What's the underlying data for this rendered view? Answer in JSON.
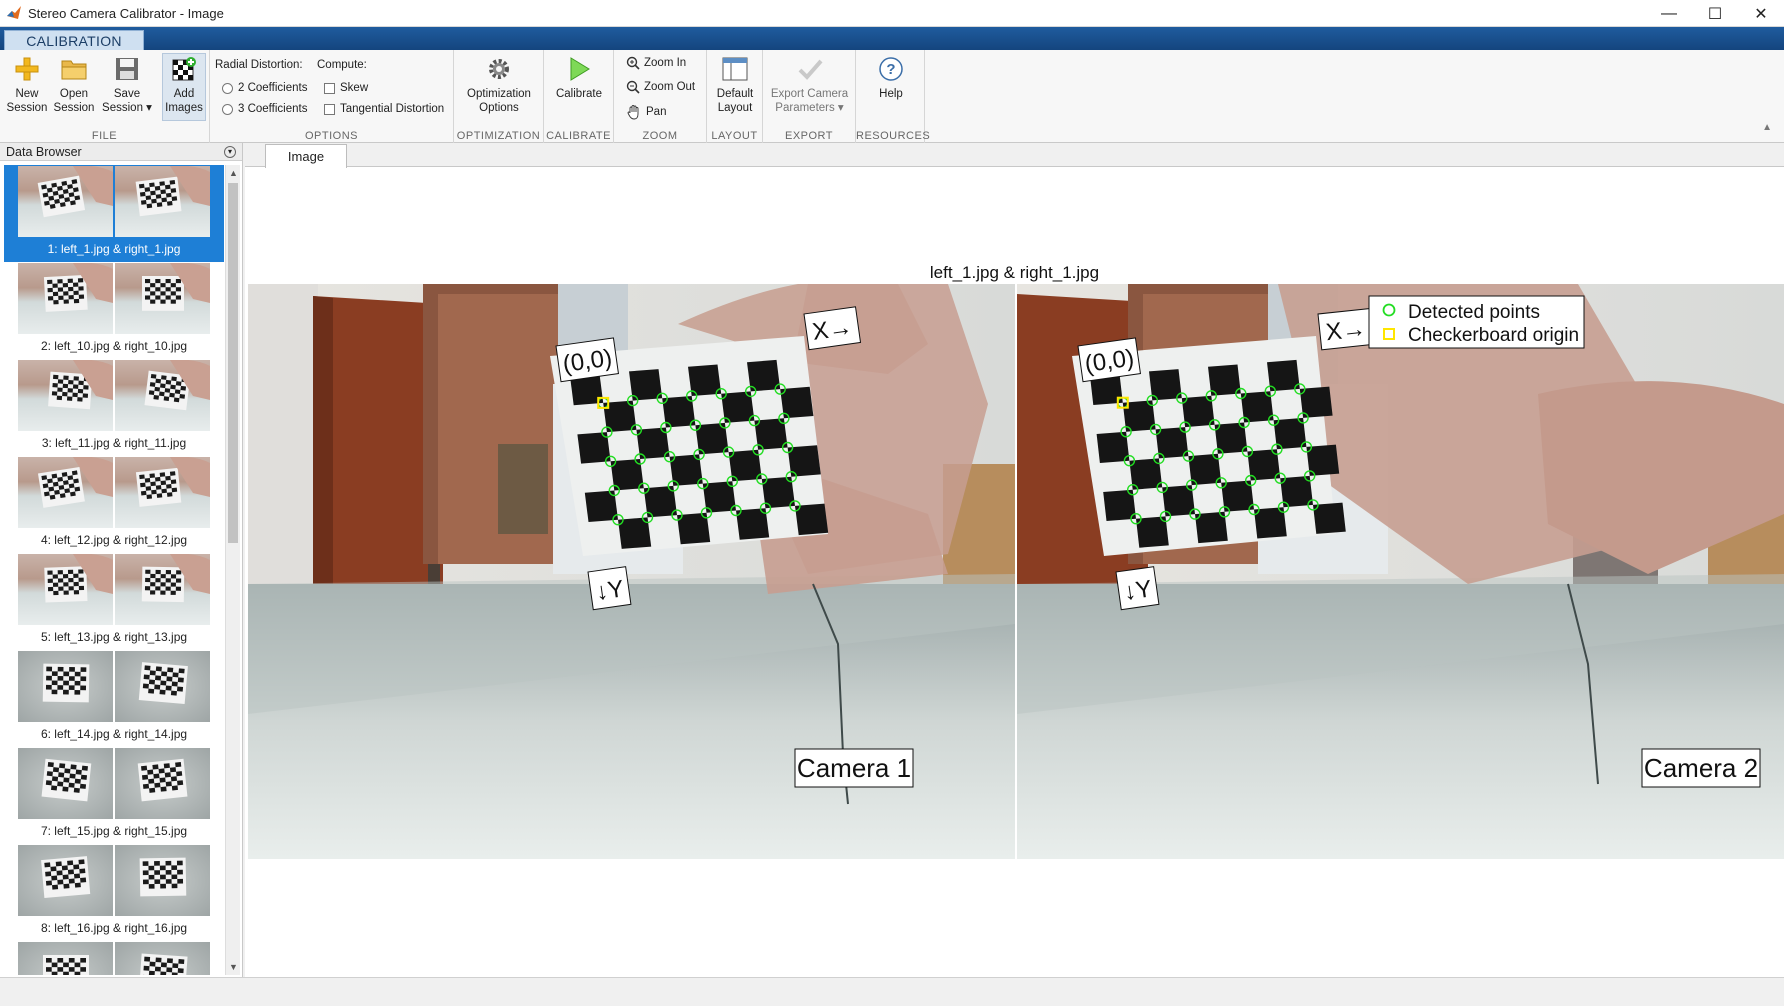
{
  "window": {
    "title": "Stereo Camera Calibrator - Image",
    "minimize": "—",
    "maximize": "☐",
    "close": "✕"
  },
  "ribbon_tab": "CALIBRATION",
  "file": {
    "label": "FILE",
    "new_session": [
      "New",
      "Session"
    ],
    "open_session": [
      "Open",
      "Session"
    ],
    "save_session": [
      "Save",
      "Session ▾"
    ],
    "add_images": [
      "Add",
      "Images"
    ]
  },
  "options": {
    "label": "OPTIONS",
    "radial_distortion": "Radial Distortion:",
    "coef2": "2 Coefficients",
    "coef3": "3 Coefficients",
    "compute": "Compute:",
    "skew": "Skew",
    "tangential": "Tangential Distortion"
  },
  "optimization": {
    "label": "OPTIMIZATION",
    "button": [
      "Optimization",
      "Options"
    ]
  },
  "calibrate": {
    "label": "CALIBRATE",
    "button": "Calibrate"
  },
  "zoom": {
    "label": "ZOOM",
    "zoom_in": "Zoom In",
    "zoom_out": "Zoom Out",
    "pan": "Pan"
  },
  "layout": {
    "label": "LAYOUT",
    "button": [
      "Default",
      "Layout"
    ]
  },
  "export": {
    "label": "EXPORT",
    "button": [
      "Export Camera",
      "Parameters ▾"
    ]
  },
  "resources": {
    "label": "RESOURCES",
    "button": "Help"
  },
  "browser": {
    "title": "Data Browser",
    "items": [
      {
        "label": "1: left_1.jpg & right_1.jpg",
        "selected": true,
        "style": "room"
      },
      {
        "label": "2: left_10.jpg & right_10.jpg",
        "style": "room"
      },
      {
        "label": "3: left_11.jpg & right_11.jpg",
        "style": "room"
      },
      {
        "label": "4: left_12.jpg & right_12.jpg",
        "style": "room"
      },
      {
        "label": "5: left_13.jpg & right_13.jpg",
        "style": "room"
      },
      {
        "label": "6: left_14.jpg & right_14.jpg",
        "style": "gray"
      },
      {
        "label": "7: left_15.jpg & right_15.jpg",
        "style": "gray"
      },
      {
        "label": "8: left_16.jpg & right_16.jpg",
        "style": "gray"
      },
      {
        "label": "",
        "style": "gray"
      }
    ]
  },
  "document_tab": "Image",
  "figure": {
    "title": "left_1.jpg & right_1.jpg",
    "camera1": "Camera 1",
    "camera2": "Camera 2",
    "origin_label": "(0,0)",
    "x_label": "X→",
    "y_label": "↓Y",
    "legend": {
      "detected": "Detected points",
      "origin": "Checkerboard origin"
    },
    "colors": {
      "detected": "#22dd22",
      "origin": "#ffe600"
    }
  }
}
